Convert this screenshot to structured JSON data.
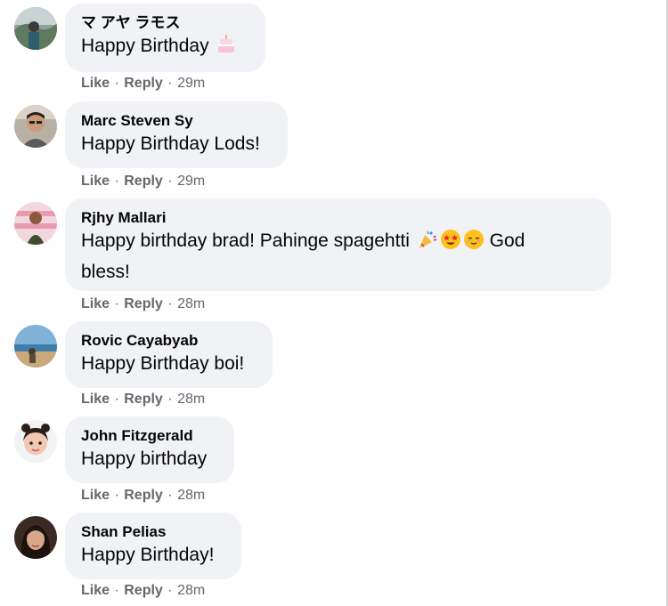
{
  "comments": [
    {
      "author": "マ アヤ ラモス",
      "text": "Happy Birthday",
      "emoji": "birthday-cake-icon",
      "like_label": "Like",
      "reply_label": "Reply",
      "separator": "·",
      "time": "29m"
    },
    {
      "author": "Marc Steven Sy",
      "text": "Happy Birthday Lods!",
      "like_label": "Like",
      "reply_label": "Reply",
      "separator": "·",
      "time": "29m"
    },
    {
      "author": "Rjhy Mallari",
      "text_part1": "Happy birthday brad! Pahinge spagehtti",
      "emojis": [
        "party-popper-icon",
        "star-struck-icon",
        "relieved-face-icon"
      ],
      "text_part2": "God",
      "text_line2": "bless!",
      "like_label": "Like",
      "reply_label": "Reply",
      "separator": "·",
      "time": "28m"
    },
    {
      "author": "Rovic Cayabyab",
      "text": "Happy Birthday boi!",
      "like_label": "Like",
      "reply_label": "Reply",
      "separator": "·",
      "time": "28m"
    },
    {
      "author": "John Fitzgerald",
      "text": "Happy birthday",
      "like_label": "Like",
      "reply_label": "Reply",
      "separator": "·",
      "time": "28m"
    },
    {
      "author": "Shan Pelias",
      "text": "Happy Birthday!",
      "like_label": "Like",
      "reply_label": "Reply",
      "separator": "·",
      "time": "28m"
    }
  ],
  "colors": {
    "bubble_bg": "#f0f2f5",
    "meta_text": "#65676b",
    "body_text": "#050505"
  }
}
